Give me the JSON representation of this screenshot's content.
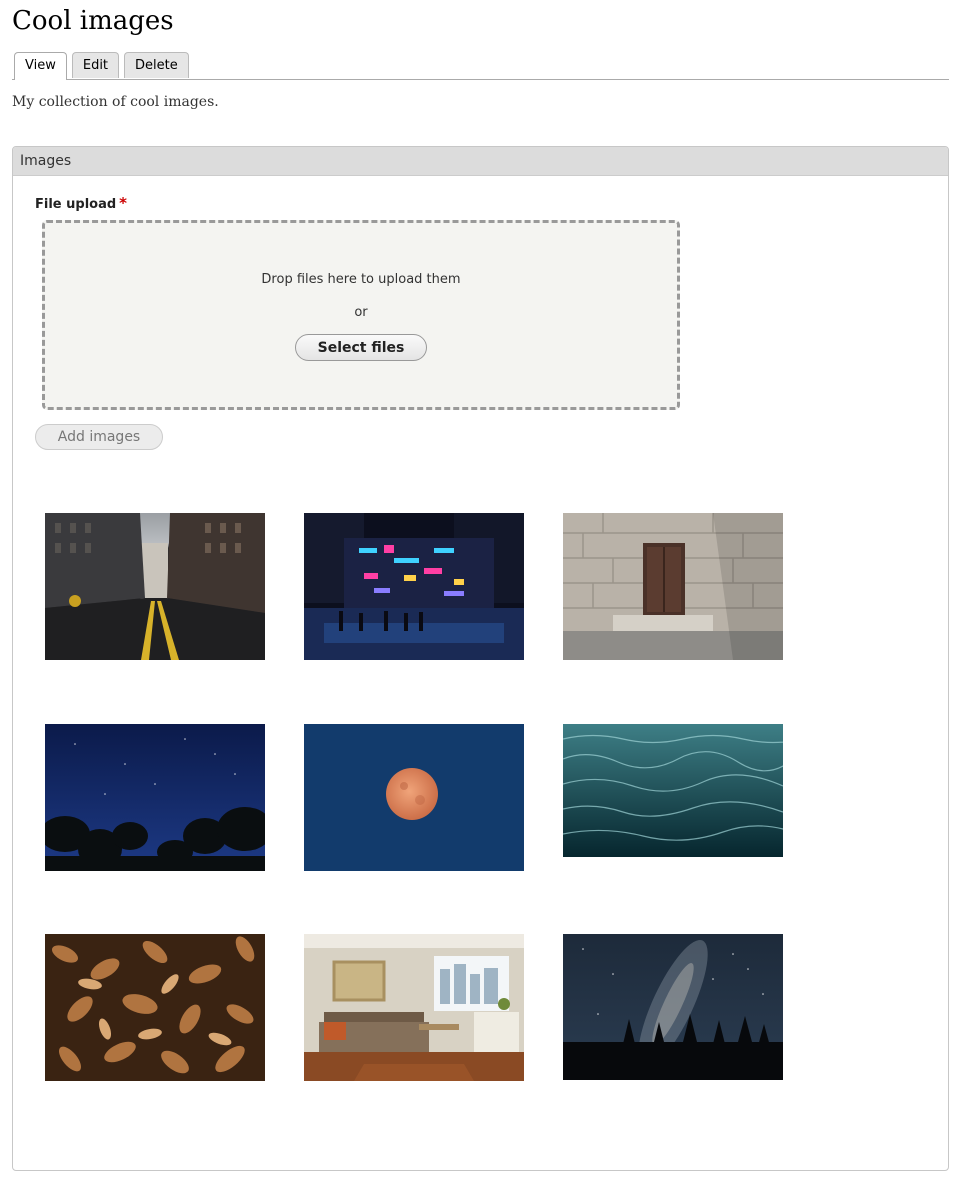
{
  "page": {
    "title": "Cool images",
    "description": "My collection of cool images."
  },
  "tabs": [
    {
      "label": "View",
      "active": true
    },
    {
      "label": "Edit",
      "active": false
    },
    {
      "label": "Delete",
      "active": false
    }
  ],
  "fieldset": {
    "legend": "Images",
    "field_label": "File upload",
    "required_mark": "*",
    "dropzone": {
      "text": "Drop files here to upload them",
      "or": "or",
      "select_button": "Select files"
    },
    "add_button": "Add images"
  },
  "gallery": {
    "images": [
      {
        "subject": "city street with yellow center lines"
      },
      {
        "subject": "neon city crossing at night"
      },
      {
        "subject": "stone building doorway"
      },
      {
        "subject": "starry night sky over trees"
      },
      {
        "subject": "orange full moon in blue sky"
      },
      {
        "subject": "dark teal water waves"
      },
      {
        "subject": "dry autumn leaves"
      },
      {
        "subject": "apartment living room"
      },
      {
        "subject": "milky way over forest"
      }
    ]
  },
  "colors": {
    "required": "#cc0000",
    "legend_bg": "#dcdcdc",
    "dropzone_bg": "#f4f4f1"
  }
}
